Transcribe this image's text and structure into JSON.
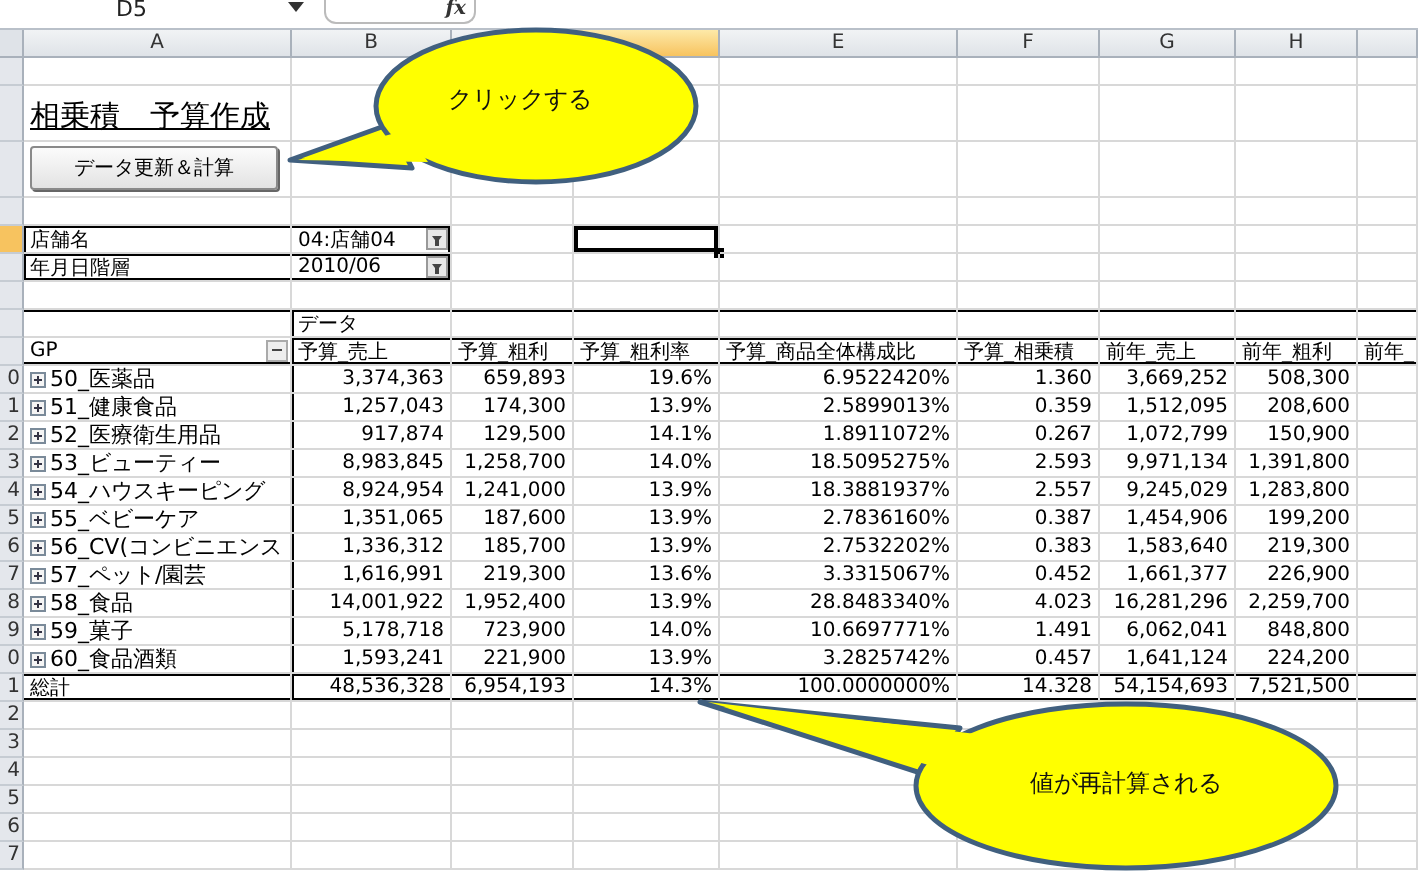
{
  "name_box": "D5",
  "formula_label": "fx",
  "columns": [
    {
      "label": "A",
      "selected": false
    },
    {
      "label": "B",
      "selected": false
    },
    {
      "selected": false
    },
    {
      "selected": true
    },
    {
      "label": "E",
      "selected": false
    },
    {
      "label": "F",
      "selected": false
    },
    {
      "label": "G",
      "selected": false
    },
    {
      "label": "H",
      "selected": false
    },
    {
      "selected": false
    }
  ],
  "row_headers": [
    {
      "selected": false
    },
    {
      "selected": false
    },
    {
      "selected": false
    },
    {
      "selected": false
    },
    {
      "selected": true
    },
    {
      "selected": false
    },
    {
      "selected": false
    },
    {
      "selected": false
    },
    {
      "selected": false
    },
    {
      "label": "0",
      "selected": false
    },
    {
      "label": "1",
      "selected": false
    },
    {
      "label": "2",
      "selected": false
    },
    {
      "label": "3",
      "selected": false
    },
    {
      "label": "4",
      "selected": false
    },
    {
      "label": "5",
      "selected": false
    },
    {
      "label": "6",
      "selected": false
    },
    {
      "label": "7",
      "selected": false
    },
    {
      "label": "8",
      "selected": false
    },
    {
      "label": "9",
      "selected": false
    },
    {
      "label": "0",
      "selected": false
    },
    {
      "label": "1",
      "selected": false
    },
    {
      "label": "2",
      "selected": false
    },
    {
      "label": "3",
      "selected": false
    },
    {
      "label": "4",
      "selected": false
    },
    {
      "label": "5",
      "selected": false
    },
    {
      "label": "6",
      "selected": false
    },
    {
      "label": "7",
      "selected": false
    }
  ],
  "title": "相乗積　予算作成",
  "button": "データ更新＆計算",
  "filters": [
    {
      "label": "店舗名",
      "value": "04:店舗04"
    },
    {
      "label": "年月日階層",
      "value": "2010/06"
    }
  ],
  "pivot": {
    "data_label": "データ",
    "row_field": "GP",
    "headers": [
      "予算_売上",
      "予算_粗利",
      "予算_粗利率",
      "予算_商品全体構成比",
      "予算_相乗積",
      "前年_売上",
      "前年_粗利",
      "前年_"
    ],
    "rows": [
      {
        "name": "50_医薬品",
        "values": [
          "3,374,363",
          "659,893",
          "19.6%",
          "6.9522420%",
          "1.360",
          "3,669,252",
          "508,300"
        ]
      },
      {
        "name": "51_健康食品",
        "values": [
          "1,257,043",
          "174,300",
          "13.9%",
          "2.5899013%",
          "0.359",
          "1,512,095",
          "208,600"
        ]
      },
      {
        "name": "52_医療衛生用品",
        "values": [
          "917,874",
          "129,500",
          "14.1%",
          "1.8911072%",
          "0.267",
          "1,072,799",
          "150,900"
        ]
      },
      {
        "name": "53_ビューティー",
        "values": [
          "8,983,845",
          "1,258,700",
          "14.0%",
          "18.5095275%",
          "2.593",
          "9,971,134",
          "1,391,800"
        ]
      },
      {
        "name": "54_ハウスキーピング",
        "values": [
          "8,924,954",
          "1,241,000",
          "13.9%",
          "18.3881937%",
          "2.557",
          "9,245,029",
          "1,283,800"
        ]
      },
      {
        "name": "55_ベビーケア",
        "values": [
          "1,351,065",
          "187,600",
          "13.9%",
          "2.7836160%",
          "0.387",
          "1,454,906",
          "199,200"
        ]
      },
      {
        "name": "56_CV(コンビニエンス",
        "values": [
          "1,336,312",
          "185,700",
          "13.9%",
          "2.7532202%",
          "0.383",
          "1,583,640",
          "219,300"
        ]
      },
      {
        "name": "57_ペット/園芸",
        "values": [
          "1,616,991",
          "219,300",
          "13.6%",
          "3.3315067%",
          "0.452",
          "1,661,377",
          "226,900"
        ]
      },
      {
        "name": "58_食品",
        "values": [
          "14,001,922",
          "1,952,400",
          "13.9%",
          "28.8483340%",
          "4.023",
          "16,281,296",
          "2,259,700"
        ]
      },
      {
        "name": "59_菓子",
        "values": [
          "5,178,718",
          "723,900",
          "14.0%",
          "10.6697771%",
          "1.491",
          "6,062,041",
          "848,800"
        ]
      },
      {
        "name": "60_食品酒類",
        "values": [
          "1,593,241",
          "221,900",
          "13.9%",
          "3.2825742%",
          "0.457",
          "1,641,124",
          "224,200"
        ]
      }
    ],
    "total": {
      "name": "総計",
      "values": [
        "48,536,328",
        "6,954,193",
        "14.3%",
        "100.0000000%",
        "14.328",
        "54,154,693",
        "7,521,500"
      ]
    }
  },
  "callouts": [
    {
      "text": "クリックする"
    },
    {
      "text": "値が再計算される"
    }
  ]
}
